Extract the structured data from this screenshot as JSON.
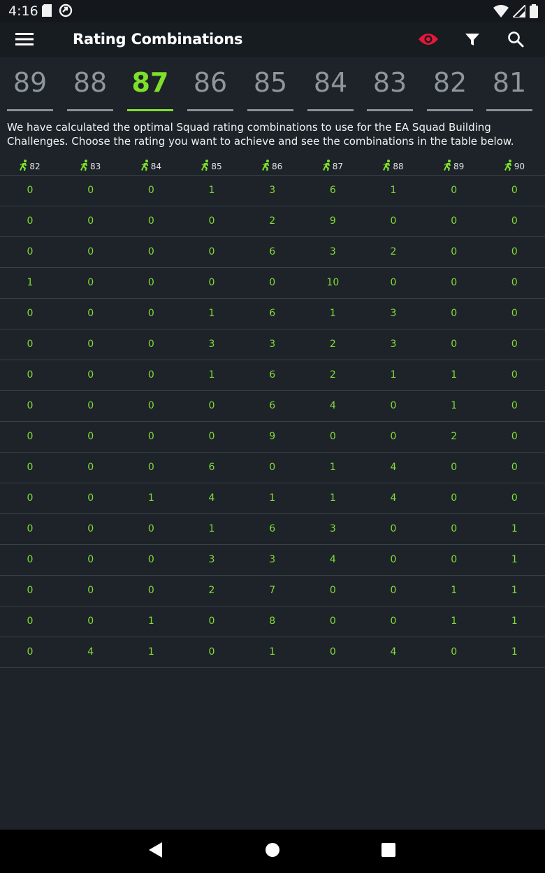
{
  "status_bar": {
    "time": "4:16",
    "left_icons": [
      "sd-card-icon",
      "sync-icon"
    ],
    "right_icons": [
      "wifi-icon",
      "signal-icon",
      "battery-icon"
    ]
  },
  "app_bar": {
    "title": "Rating Combinations",
    "eye_color": "#e8163a",
    "icons": [
      "menu-icon",
      "eye-icon",
      "filter-icon",
      "search-icon"
    ]
  },
  "rating_tabs": {
    "items": [
      "89",
      "88",
      "87",
      "86",
      "85",
      "84",
      "83",
      "82",
      "81"
    ],
    "selected": "87",
    "active_color": "#7ee02a"
  },
  "intro_text": "We have calculated the optimal Squad rating combinations to use for the EA Squad Building Challenges. Choose the rating you want to achieve and see the combinations in the table below.",
  "table": {
    "header_icon": "player-icon",
    "columns": [
      "82",
      "83",
      "84",
      "85",
      "86",
      "87",
      "88",
      "89",
      "90"
    ],
    "rows": [
      [
        "0",
        "0",
        "0",
        "1",
        "3",
        "6",
        "1",
        "0",
        "0"
      ],
      [
        "0",
        "0",
        "0",
        "0",
        "2",
        "9",
        "0",
        "0",
        "0"
      ],
      [
        "0",
        "0",
        "0",
        "0",
        "6",
        "3",
        "2",
        "0",
        "0"
      ],
      [
        "1",
        "0",
        "0",
        "0",
        "0",
        "10",
        "0",
        "0",
        "0"
      ],
      [
        "0",
        "0",
        "0",
        "1",
        "6",
        "1",
        "3",
        "0",
        "0"
      ],
      [
        "0",
        "0",
        "0",
        "3",
        "3",
        "2",
        "3",
        "0",
        "0"
      ],
      [
        "0",
        "0",
        "0",
        "1",
        "6",
        "2",
        "1",
        "1",
        "0"
      ],
      [
        "0",
        "0",
        "0",
        "0",
        "6",
        "4",
        "0",
        "1",
        "0"
      ],
      [
        "0",
        "0",
        "0",
        "0",
        "9",
        "0",
        "0",
        "2",
        "0"
      ],
      [
        "0",
        "0",
        "0",
        "6",
        "0",
        "1",
        "4",
        "0",
        "0"
      ],
      [
        "0",
        "0",
        "1",
        "4",
        "1",
        "1",
        "4",
        "0",
        "0"
      ],
      [
        "0",
        "0",
        "0",
        "1",
        "6",
        "3",
        "0",
        "0",
        "1"
      ],
      [
        "0",
        "0",
        "0",
        "3",
        "3",
        "4",
        "0",
        "0",
        "1"
      ],
      [
        "0",
        "0",
        "0",
        "2",
        "7",
        "0",
        "0",
        "1",
        "1"
      ],
      [
        "0",
        "0",
        "1",
        "0",
        "8",
        "0",
        "0",
        "1",
        "1"
      ],
      [
        "0",
        "4",
        "1",
        "0",
        "1",
        "0",
        "4",
        "0",
        "1"
      ]
    ]
  },
  "nav_bar": {
    "icons": [
      "back-icon",
      "home-icon",
      "recents-icon"
    ]
  }
}
